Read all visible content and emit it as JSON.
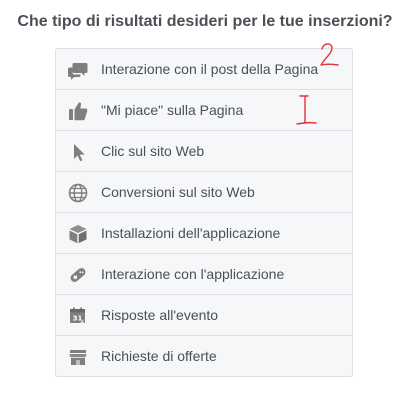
{
  "heading": "Che tipo di risultati desideri per le tue inserzioni?",
  "options": [
    {
      "label": "Interazione con il post della Pagina",
      "icon": "speech-bubbles-icon"
    },
    {
      "label": "\"Mi piace\" sulla Pagina",
      "icon": "thumbs-up-icon"
    },
    {
      "label": "Clic sul sito Web",
      "icon": "cursor-pointer-icon"
    },
    {
      "label": "Conversioni sul sito Web",
      "icon": "globe-icon"
    },
    {
      "label": "Installazioni dell'applicazione",
      "icon": "package-box-icon"
    },
    {
      "label": "Interazione con l'applicazione",
      "icon": "game-controller-icon"
    },
    {
      "label": "Risposte all'evento",
      "icon": "calendar-icon"
    },
    {
      "label": "Richieste di offerte",
      "icon": "storefront-icon"
    }
  ],
  "annotations": {
    "number_two": "2",
    "number_one": "1"
  },
  "colors": {
    "heading_text": "#4b4f56",
    "option_text": "#4b4f56",
    "option_background": "#f6f7f9",
    "border": "#dddfe2",
    "icon": "#7f7f7f",
    "annotation_red": "#e0343a"
  }
}
